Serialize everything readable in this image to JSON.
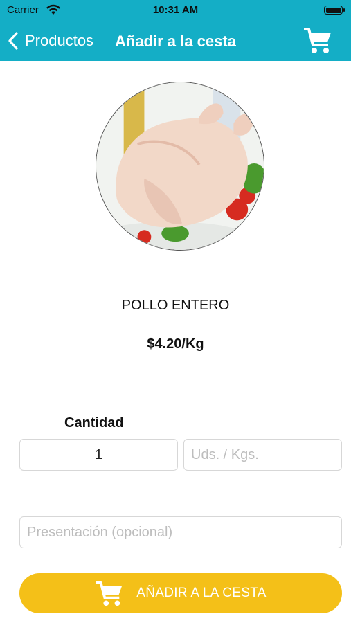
{
  "status_bar": {
    "carrier": "Carrier",
    "time": "10:31 AM"
  },
  "nav": {
    "back_label": "Productos",
    "title": "Añadir a la cesta"
  },
  "product": {
    "name": "POLLO ENTERO",
    "price": "$4.20/Kg"
  },
  "quantity": {
    "label": "Cantidad",
    "value": "1"
  },
  "unit_field": {
    "placeholder": "Uds. / Kgs."
  },
  "presentation_field": {
    "placeholder": "Presentación (opcional)"
  },
  "add_button": {
    "label": "AÑADIR A LA CESTA"
  },
  "colors": {
    "header": "#14aec6",
    "button": "#f4c018"
  },
  "icons": [
    "wifi-icon",
    "battery-icon",
    "back-chevron-icon",
    "cart-icon"
  ]
}
